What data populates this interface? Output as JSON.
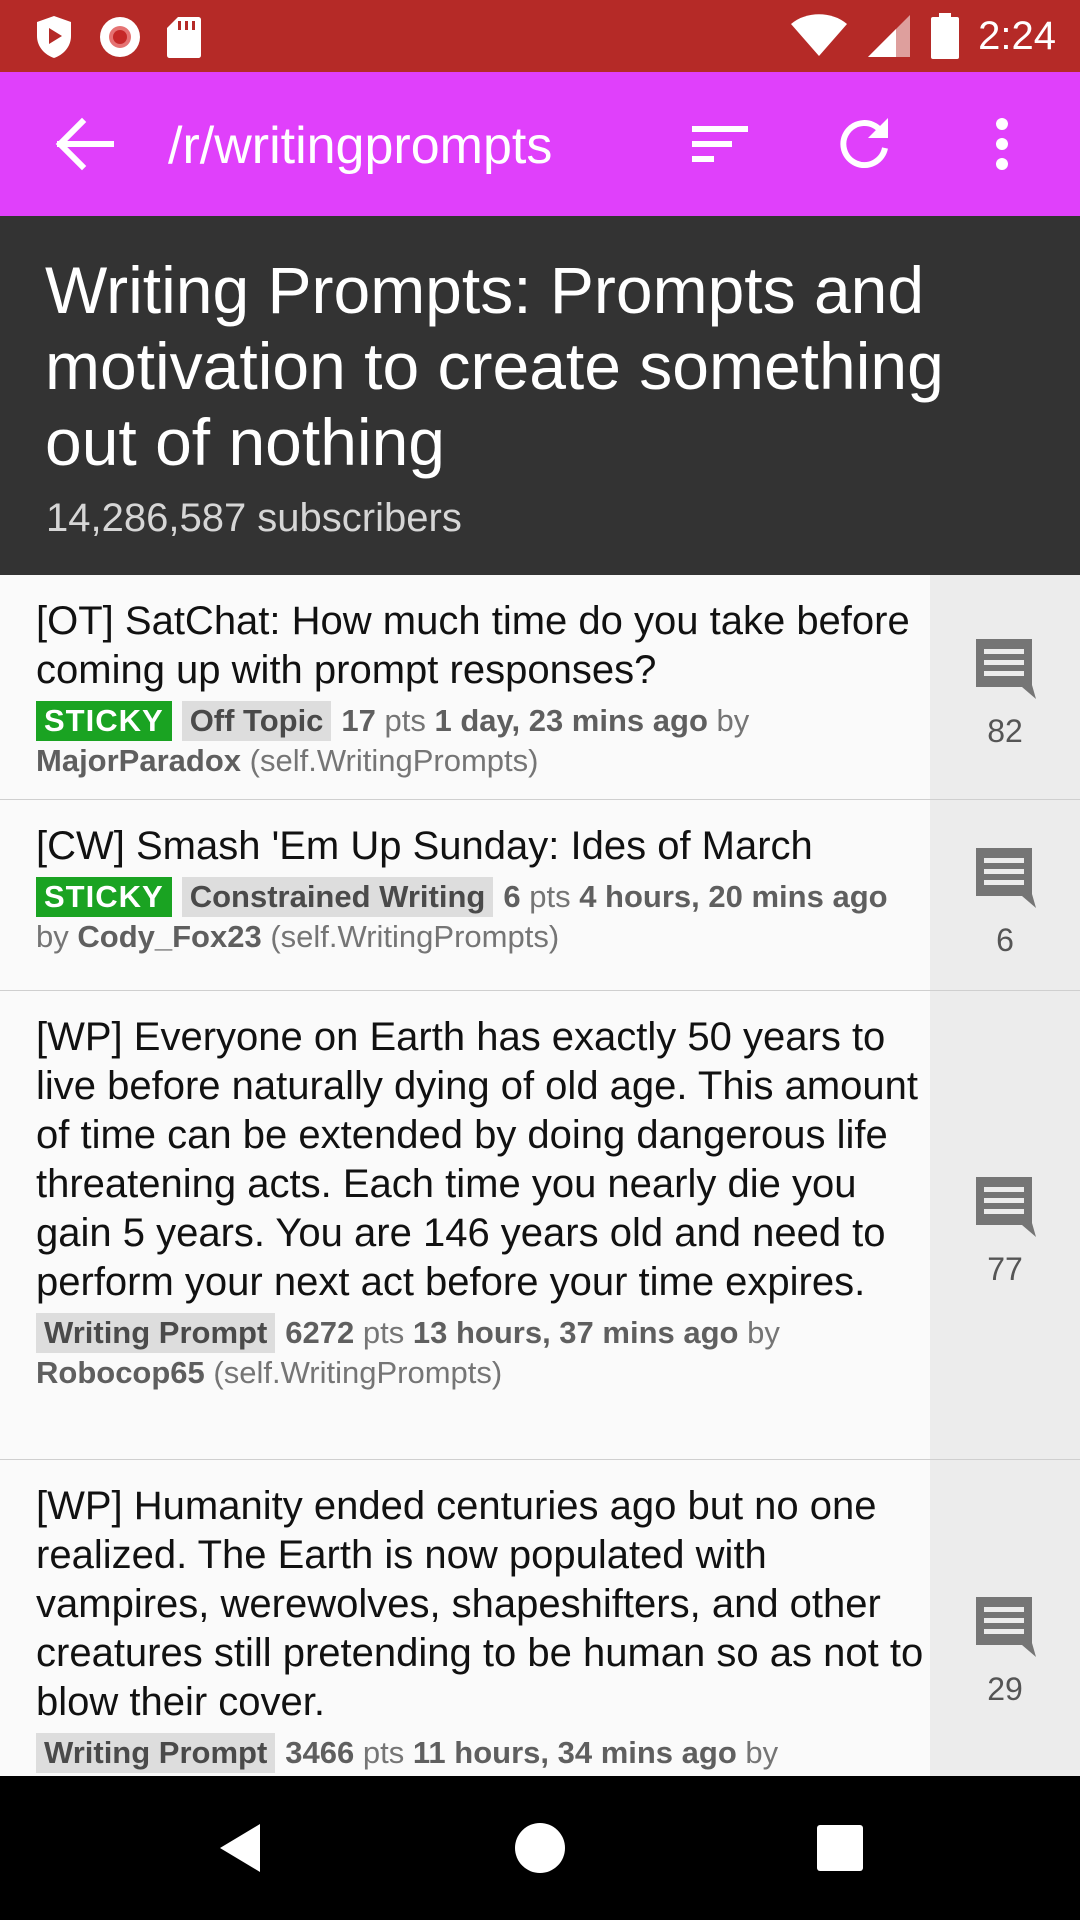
{
  "status_bar": {
    "time": "2:24",
    "icons_left": [
      "shield-play-icon",
      "record-icon",
      "sd-card-icon"
    ],
    "icons_right": [
      "wifi-icon",
      "signal-icon",
      "battery-icon"
    ]
  },
  "app_bar": {
    "title": "/r/writingprompts",
    "color": "#e040fb",
    "actions": [
      "sort-icon",
      "refresh-icon",
      "more-vert-icon"
    ]
  },
  "header": {
    "title": "Writing Prompts: Prompts and motivation to create something out of nothing",
    "subscribers": "14,286,587 subscribers"
  },
  "posts": [
    {
      "title": "[OT] SatChat: How much time do you take before coming up with prompt responses?",
      "sticky": "STICKY",
      "flair": "Off Topic",
      "score": "17",
      "pts_label": "pts",
      "time": "1 day, 23 mins ago",
      "by": "by",
      "author": "MajorParadox",
      "domain": "(self.WritingPrompts)",
      "comments": "82"
    },
    {
      "title": "[CW] Smash 'Em Up Sunday: Ides of March",
      "sticky": "STICKY",
      "flair": "Constrained Writing",
      "score": "6",
      "pts_label": "pts",
      "time": "4 hours, 20 mins ago",
      "by": "by",
      "author": "Cody_Fox23",
      "domain": "(self.WritingPrompts)",
      "comments": "6"
    },
    {
      "title": "[WP] Everyone on Earth has exactly 50 years to live before naturally dying of old age. This amount of time can be extended by doing dangerous life threatening acts. Each time you nearly die you gain 5 years. You are 146 years old and need to perform your next act before your time expires.",
      "flair": "Writing Prompt",
      "score": "6272",
      "pts_label": "pts",
      "time": "13 hours, 37 mins ago",
      "by": "by",
      "author": "Robocop65",
      "domain": "(self.WritingPrompts)",
      "comments": "77"
    },
    {
      "title": "[WP] Humanity ended centuries ago but no one realized. The Earth is now populated with vampires, werewolves, shapeshifters, and other creatures still pretending to be human so as not to blow their cover.",
      "flair": "Writing Prompt",
      "score": "3466",
      "pts_label": "pts",
      "time": "11 hours, 34 mins ago",
      "by": "by",
      "comments": "29"
    }
  ],
  "nav_bar": [
    "back-triangle-icon",
    "home-circle-icon",
    "recents-square-icon"
  ]
}
